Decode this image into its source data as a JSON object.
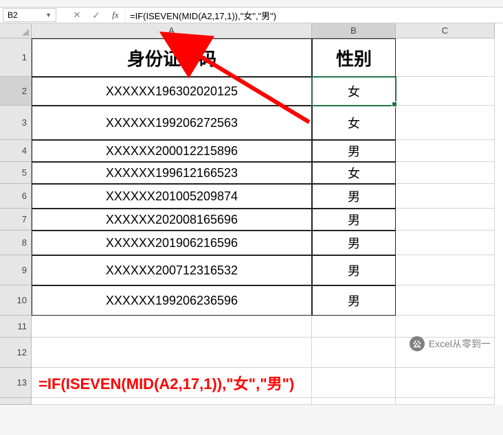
{
  "name_box": "B2",
  "formula": "=IF(ISEVEN(MID(A2,17,1)),\"女\",\"男\")",
  "columns": [
    "A",
    "B",
    "C"
  ],
  "headers": {
    "id": "身份证号码",
    "gender": "性别"
  },
  "rows": [
    {
      "num": "1"
    },
    {
      "num": "2",
      "id": "XXXXXX196302020125",
      "gender": "女"
    },
    {
      "num": "3",
      "id": "XXXXXX199206272563",
      "gender": "女"
    },
    {
      "num": "4",
      "id": "XXXXXX200012215896",
      "gender": "男"
    },
    {
      "num": "5",
      "id": "XXXXXX199612166523",
      "gender": "女"
    },
    {
      "num": "6",
      "id": "XXXXXX201005209874",
      "gender": "男"
    },
    {
      "num": "7",
      "id": "XXXXXX202008165696",
      "gender": "男"
    },
    {
      "num": "8",
      "id": "XXXXXX201906216596",
      "gender": "男"
    },
    {
      "num": "9",
      "id": "XXXXXX200712316532",
      "gender": "男"
    },
    {
      "num": "10",
      "id": "XXXXXX199206236596",
      "gender": "男"
    },
    {
      "num": "11"
    },
    {
      "num": "12"
    },
    {
      "num": "13"
    }
  ],
  "formula_display": "=IF(ISEVEN(MID(A2,17,1)),\"女\",\"男\")",
  "watermark_text": "Excel从零到一",
  "watermark_icon": "公"
}
